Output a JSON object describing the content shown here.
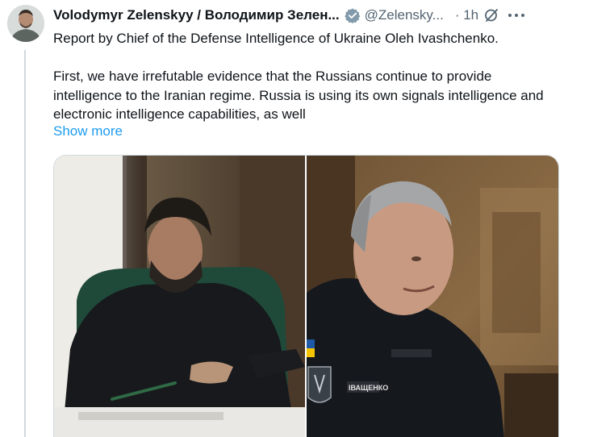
{
  "tweet": {
    "author_name": "Volodymyr Zelenskyy / Володимир Зелен...",
    "handle": "@Zelensky...",
    "time": "· 1h",
    "text_lines": [
      "Report by Chief of the Defense Intelligence of Ukraine Oleh Ivashchenko.",
      "First, we have irrefutable evidence that the Russians continue to provide intelligence to the Iranian regime. Russia is using its own signals intelligence and electronic intelligence capabilities, as well"
    ],
    "show_more_label": "Show more",
    "media": {
      "left_photo_alt": "Volodymyr Zelenskyy reading documents at a desk",
      "right_photo_alt": "Oleh Ivashchenko speaking"
    },
    "patch_text": "ІВАЩЕНКО",
    "colors": {
      "link": "#1d9bf0",
      "verified": "#829aab",
      "text": "#0f1419",
      "secondary": "#536471"
    }
  }
}
